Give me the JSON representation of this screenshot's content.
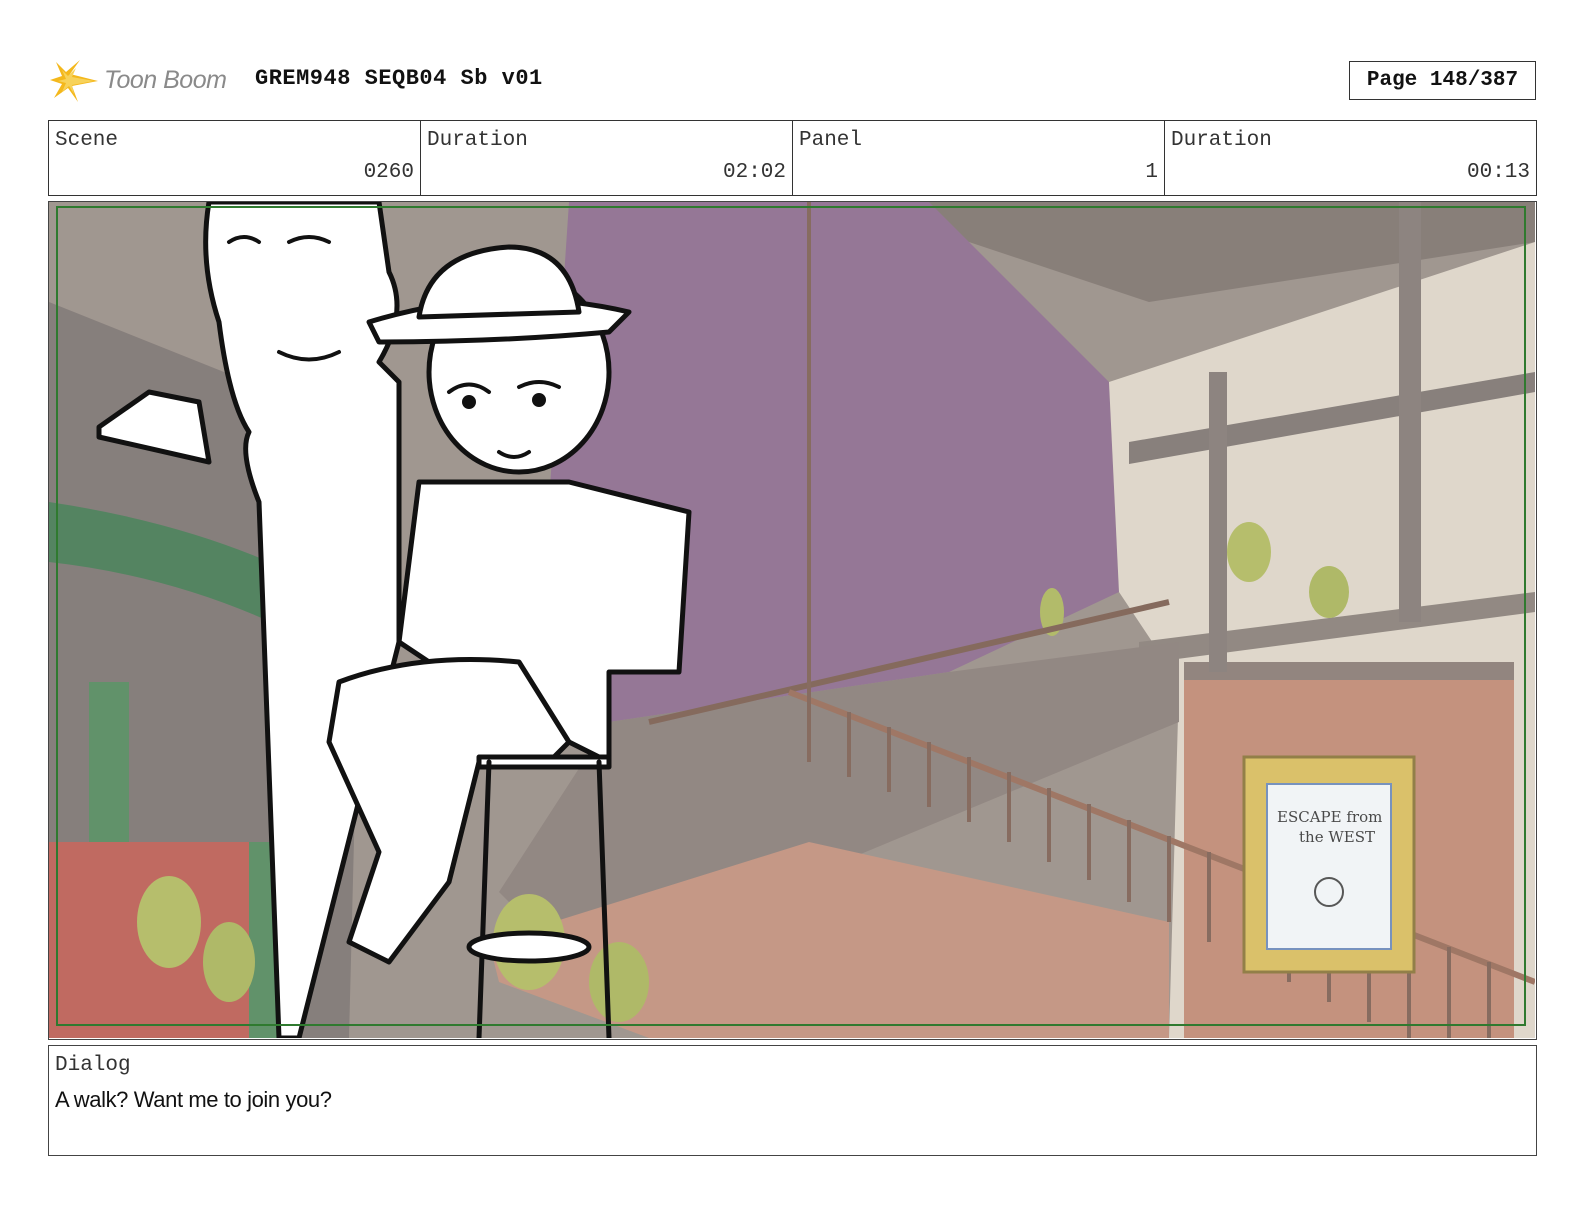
{
  "header": {
    "logo_text": "Toon Boom",
    "doc_title": "GREM948 SEQB04 Sb v01",
    "page_label": "Page 148/387"
  },
  "info": {
    "scene_label": "Scene",
    "scene_value": "0260",
    "scene_duration_label": "Duration",
    "scene_duration_value": "02:02",
    "panel_label": "Panel",
    "panel_value": "1",
    "panel_duration_label": "Duration",
    "panel_duration_value": "00:13"
  },
  "panel_image": {
    "poster_line1": "ESCAPE from",
    "poster_line2": "the WEST",
    "colors": {
      "wall_purple": "#7e5a7f",
      "frame_green": "#2f7a2f",
      "stucco": "#c38672"
    }
  },
  "dialog": {
    "label": "Dialog",
    "text": "A walk? Want me to join you?"
  }
}
